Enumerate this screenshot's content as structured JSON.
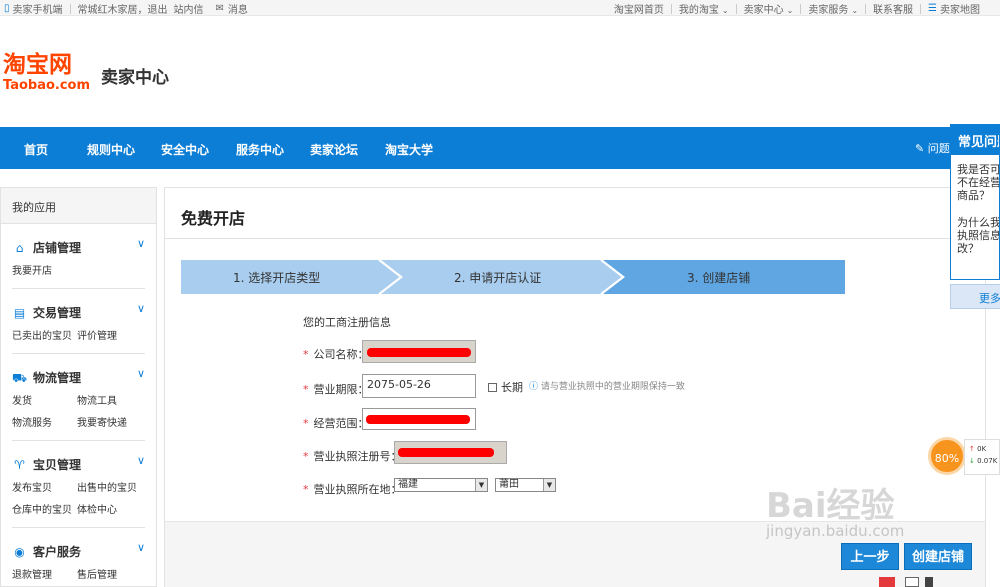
{
  "topbar": {
    "mobile": "卖家手机端",
    "user_info": "常城红木家居，退出",
    "inbox": "站内信",
    "messages": "消息",
    "home": "淘宝网首页",
    "my_taobao": "我的淘宝",
    "seller_center": "卖家中心",
    "seller_service": "卖家服务",
    "contact": "联系客服",
    "site_map": "卖家地图"
  },
  "header": {
    "logo_cn": "淘宝网",
    "logo_en": "Taobao.com",
    "title": "卖家中心"
  },
  "nav": {
    "items": [
      "首页",
      "规则中心",
      "安全中心",
      "服务中心",
      "卖家论坛",
      "淘宝大学"
    ],
    "right": "问题"
  },
  "sidebar": {
    "header": "我的应用",
    "groups": [
      {
        "title": "店铺管理",
        "icon": "store-icon",
        "links": [
          "我要开店"
        ]
      },
      {
        "title": "交易管理",
        "icon": "document-icon",
        "links": [
          "已卖出的宝贝",
          "评价管理"
        ]
      },
      {
        "title": "物流管理",
        "icon": "truck-icon",
        "links": [
          "发货",
          "物流工具",
          "物流服务",
          "我要寄快递"
        ]
      },
      {
        "title": "宝贝管理",
        "icon": "shirt-icon",
        "links": [
          "发布宝贝",
          "出售中的宝贝",
          "仓库中的宝贝",
          "体检中心"
        ]
      },
      {
        "title": "客户服务",
        "icon": "person-icon",
        "links": [
          "退款管理",
          "售后管理"
        ]
      }
    ]
  },
  "main": {
    "title": "免费开店",
    "steps": [
      "1. 选择开店类型",
      "2. 申请开店认证",
      "3. 创建店铺"
    ],
    "section_title": "您的工商注册信息",
    "fields": {
      "company_label": "公司名称：",
      "period_label": "营业期限：",
      "period_value": "2075-05-26",
      "longterm_label": "长期",
      "period_hint": "请与营业执照中的营业期限保持一致",
      "scope_label": "经营范围：",
      "license_label": "营业执照注册号：",
      "location_label": "营业执照所在地：",
      "province": "福建",
      "city": "莆田"
    },
    "buttons": {
      "prev": "上一步",
      "create": "创建店铺"
    }
  },
  "faq": {
    "title": "常见问题",
    "q1": [
      "我是否可",
      "不在经营",
      "商品？"
    ],
    "q2": [
      "为什么我",
      "执照信息",
      "改？"
    ],
    "more": "更多"
  },
  "speed": {
    "percent": "80%",
    "up": "0K",
    "down": "0.07K"
  },
  "watermark": {
    "main": "Bai经验",
    "sub": "jingyan.baidu.com"
  }
}
